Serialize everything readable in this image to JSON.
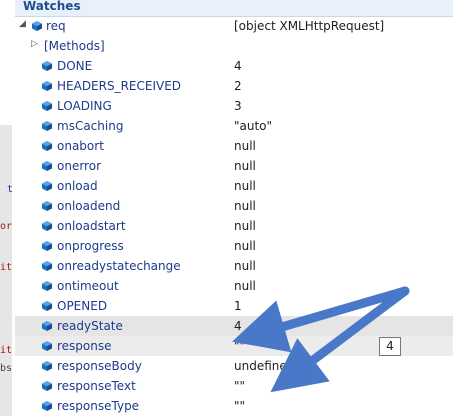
{
  "panel": {
    "title": "Watches"
  },
  "left_code": [
    "t",
    "or",
    "it",
    "it",
    "bs"
  ],
  "root": {
    "name": "req",
    "value": "[object XMLHttpRequest]"
  },
  "methods": {
    "name": "[Methods]"
  },
  "properties": [
    {
      "name": "DONE",
      "value": "4"
    },
    {
      "name": "HEADERS_RECEIVED",
      "value": "2"
    },
    {
      "name": "LOADING",
      "value": "3"
    },
    {
      "name": "msCaching",
      "value": "\"auto\""
    },
    {
      "name": "onabort",
      "value": "null"
    },
    {
      "name": "onerror",
      "value": "null"
    },
    {
      "name": "onload",
      "value": "null"
    },
    {
      "name": "onloadend",
      "value": "null"
    },
    {
      "name": "onloadstart",
      "value": "null"
    },
    {
      "name": "onprogress",
      "value": "null"
    },
    {
      "name": "onreadystatechange",
      "value": "null"
    },
    {
      "name": "ontimeout",
      "value": "null"
    },
    {
      "name": "OPENED",
      "value": "1"
    },
    {
      "name": "readyState",
      "value": "4"
    },
    {
      "name": "response",
      "value": "\"\""
    },
    {
      "name": "responseBody",
      "value": "undefined"
    },
    {
      "name": "responseText",
      "value": "\"\""
    },
    {
      "name": "responseType",
      "value": "\"\""
    }
  ],
  "tooltip": {
    "text": "4"
  },
  "colors": {
    "annotation_arrow": "#4a78c8",
    "cube": "#1f6fbf",
    "header_text": "#1e4e8c"
  }
}
